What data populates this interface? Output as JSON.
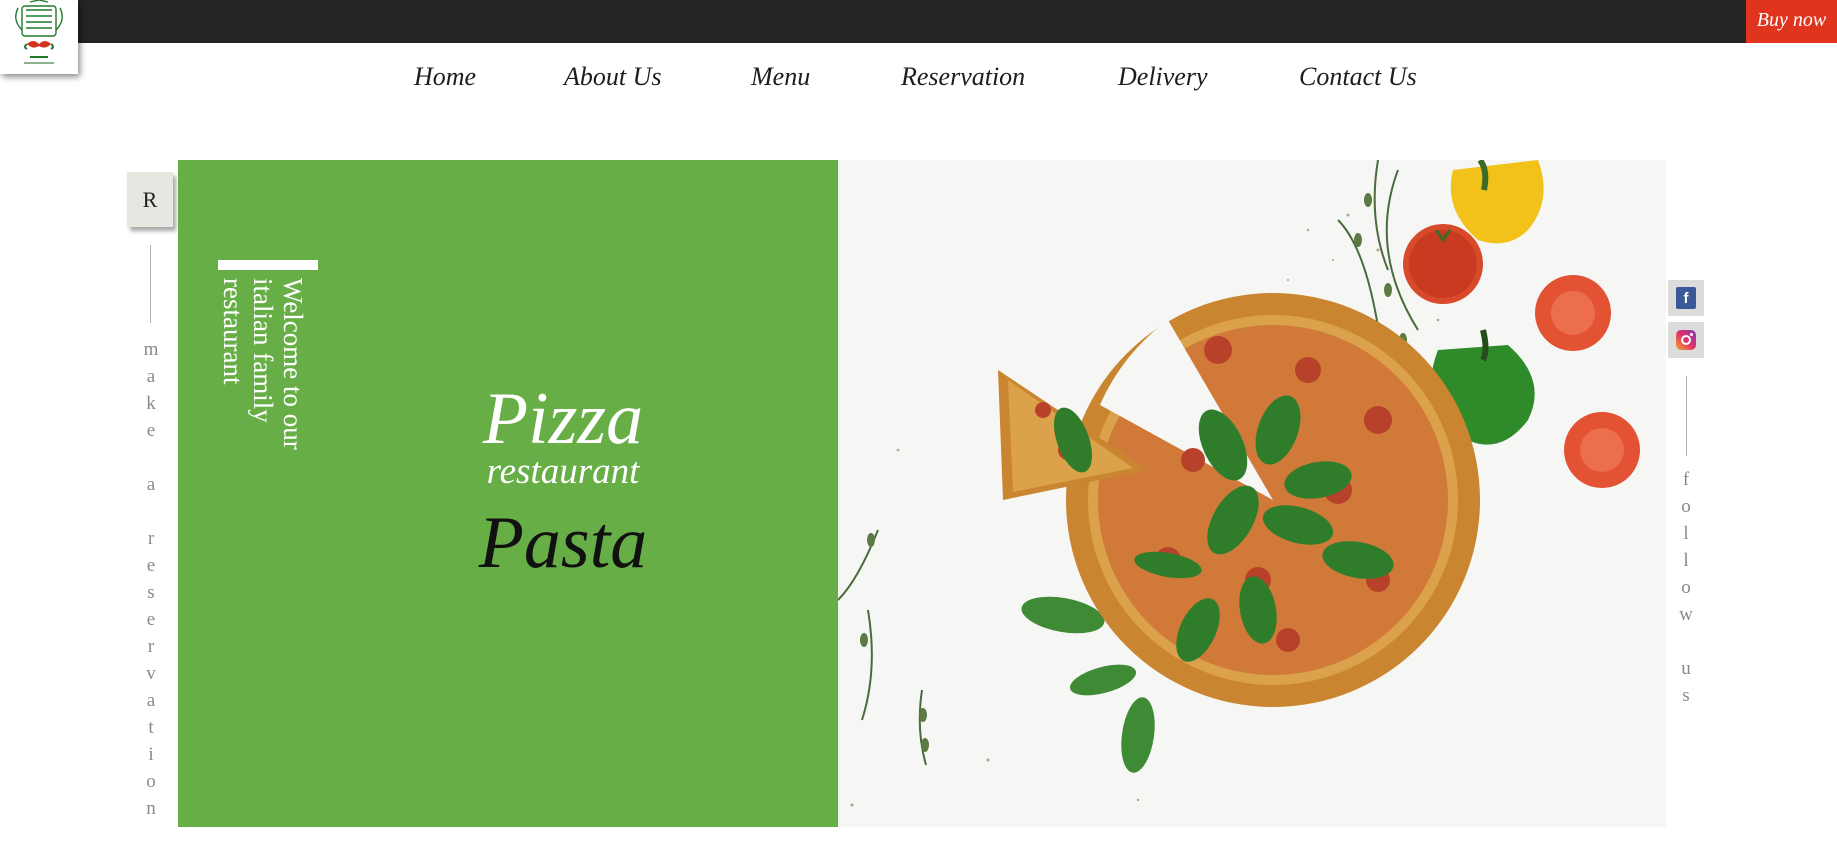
{
  "header": {
    "buy_now_label": "Buy now",
    "logo_icon": "restaurant-crest-icon"
  },
  "nav": {
    "items": [
      {
        "label": "Home"
      },
      {
        "label": "About Us"
      },
      {
        "label": "Menu"
      },
      {
        "label": "Reservation"
      },
      {
        "label": "Delivery"
      },
      {
        "label": "Contact Us"
      }
    ]
  },
  "side_left": {
    "badge_label": "R",
    "letters": [
      "m",
      "a",
      "k",
      "e",
      " ",
      "a",
      " ",
      "r",
      "e",
      "s",
      "e",
      "r",
      "v",
      "a",
      "t",
      "i",
      "o",
      "n"
    ]
  },
  "side_right": {
    "letters": [
      "f",
      "o",
      "l",
      "l",
      "o",
      "w",
      " ",
      "u",
      "s"
    ],
    "social_icons": [
      "facebook-icon",
      "instagram-icon"
    ]
  },
  "hero": {
    "welcome_text": "Welcome to our\nitalian family\nrestaurant",
    "title_pizza": "Pizza",
    "title_restaurant": "restaurant",
    "title_pasta": "Pasta",
    "image_subject": "pizza-with-basil-and-vegetables-photo"
  },
  "colors": {
    "topbar": "#242424",
    "buy_now_bg": "#e0341f",
    "hero_green": "#67ae47",
    "text_dark": "#1d1d1d",
    "side_text": "#8a8a8a"
  }
}
